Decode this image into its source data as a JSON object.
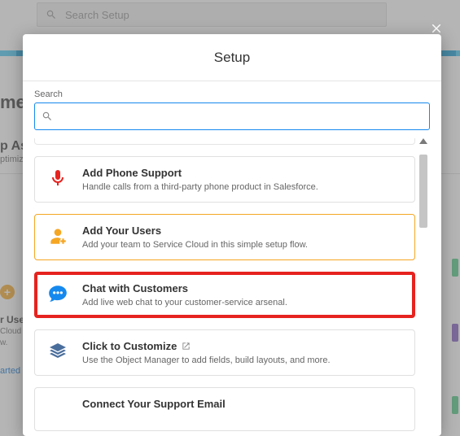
{
  "bg": {
    "search_placeholder": "Search Setup",
    "title_fragment": "me",
    "assist_fragment": "p Ass",
    "optimize_fragment": "ptimize",
    "plus_glyph": "+",
    "user_fragment": "r Use",
    "cloud_fragment": "Cloud i",
    "w_fragment": "w.",
    "started_fragment": "arted"
  },
  "modal": {
    "title": "Setup",
    "search_label": "Search",
    "close_glyph": "×"
  },
  "cards": [
    {
      "title": "Add Phone Support",
      "desc": "Handle calls from a third-party phone product in Salesforce."
    },
    {
      "title": "Add Your Users",
      "desc": "Add your team to Service Cloud in this simple setup flow."
    },
    {
      "title": "Chat with Customers",
      "desc": "Add live web chat to your customer-service arsenal."
    },
    {
      "title": "Click to Customize",
      "desc": "Use the Object Manager to add fields, build layouts, and more."
    },
    {
      "title": "Connect Your Support Email",
      "desc": ""
    }
  ]
}
